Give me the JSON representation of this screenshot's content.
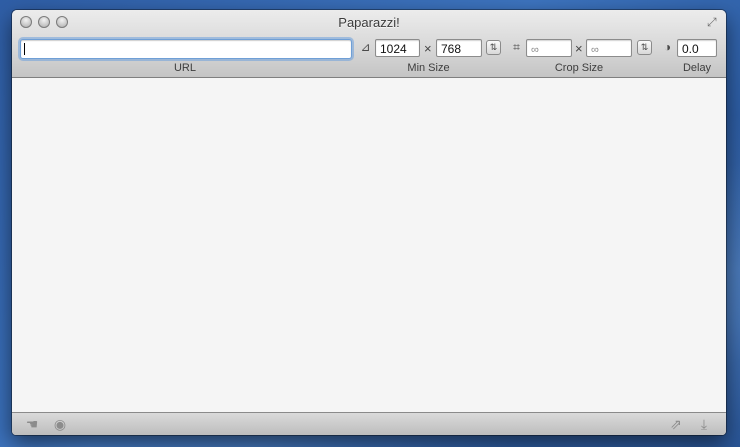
{
  "window": {
    "title": "Paparazzi!"
  },
  "toolbar": {
    "url": {
      "label": "URL",
      "value": ""
    },
    "min_size": {
      "label": "Min Size",
      "width": "1024",
      "separator": "×",
      "height": "768"
    },
    "crop_size": {
      "label": "Crop Size",
      "width_placeholder": "∞",
      "separator": "×",
      "height_placeholder": "∞"
    },
    "delay": {
      "label": "Delay",
      "value": "0.0"
    }
  },
  "icons": {
    "min_size": "resize-icon",
    "crop": "crop-icon",
    "delay": "clock-icon",
    "swap": "swap-icon",
    "hand": "hand-icon",
    "eye": "eye-icon",
    "share": "share-icon",
    "download": "download-icon",
    "fullscreen": "fullscreen-icon"
  }
}
